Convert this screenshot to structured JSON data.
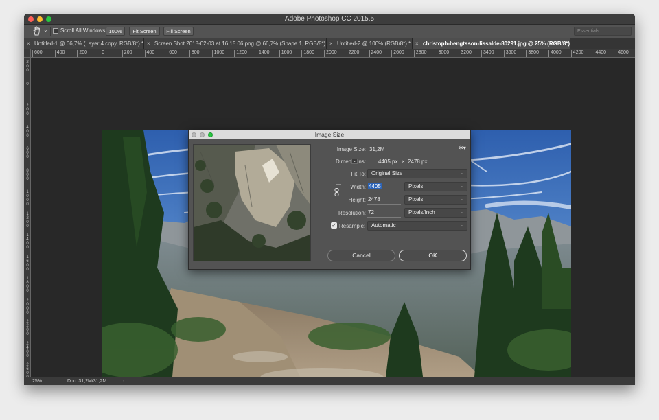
{
  "app": {
    "title": "Adobe Photoshop CC 2015.5"
  },
  "options_bar": {
    "scroll_all_windows": "Scroll All Windows",
    "zoom_100": "100%",
    "fit_screen": "Fit Screen",
    "fill_screen": "Fill Screen",
    "workspace": "Essentials"
  },
  "tabs": [
    {
      "label": "Untitled-1 @ 66,7% (Layer 4 copy, RGB/8*) *"
    },
    {
      "label": "Screen Shot 2018-02-03 at 16.15.06.png @ 66,7% (Shape 1, RGB/8*) *"
    },
    {
      "label": "Untitled-2 @ 100% (RGB/8*) *"
    },
    {
      "label": "christoph-bengtsson-lissalde-80291.jpg @ 25% (RGB/8*) *"
    }
  ],
  "ruler": {
    "h_ticks": [
      "600",
      "400",
      "200",
      "0",
      "200",
      "400",
      "600",
      "800",
      "1000",
      "1200",
      "1400",
      "1600",
      "1800",
      "2000",
      "2200",
      "2400",
      "2600",
      "2800",
      "3000",
      "3200",
      "3400",
      "3600",
      "3800",
      "4000",
      "4200",
      "4400",
      "4600",
      "4800"
    ],
    "v_ticks": [
      "2\n0\n0",
      "0",
      "2\n0\n0",
      "4\n0\n0",
      "6\n0\n0",
      "8\n0\n0",
      "1\n0\n0\n0",
      "1\n2\n0\n0",
      "1\n4\n0\n0",
      "1\n6\n0\n0",
      "1\n8\n0\n0",
      "2\n0\n0\n0",
      "2\n2\n0\n0",
      "2\n4\n0\n0",
      "2\n6\n0\n0"
    ]
  },
  "status_bar": {
    "zoom": "25%",
    "doc": "Doc: 31,2M/31,2M",
    "arrow": "›"
  },
  "dialog": {
    "title": "Image Size",
    "image_size_label": "Image Size:",
    "image_size_value": "31,2M",
    "dimensions_label": "Dimensions:",
    "dimensions_width": "4405 px",
    "dimensions_times": "×",
    "dimensions_height": "2478 px",
    "fit_to_label": "Fit To:",
    "fit_to_value": "Original Size",
    "width_label": "Width:",
    "width_value": "4405",
    "width_unit": "Pixels",
    "height_label": "Height:",
    "height_value": "2478",
    "height_unit": "Pixels",
    "resolution_label": "Resolution:",
    "resolution_value": "72",
    "resolution_unit": "Pixels/Inch",
    "resample_label": "Resample:",
    "resample_value": "Automatic",
    "cancel_label": "Cancel",
    "ok_label": "OK"
  },
  "icons": {
    "hand_tool": "hand-icon",
    "gear": "gear-icon",
    "chain": "link-icon",
    "checkmark": "check-icon",
    "close_tab": "close-icon"
  },
  "colors": {
    "accent_selection": "#2d64b7",
    "close": "#fc5f57",
    "minimize": "#fdbb2e",
    "maximize": "#28c840"
  }
}
